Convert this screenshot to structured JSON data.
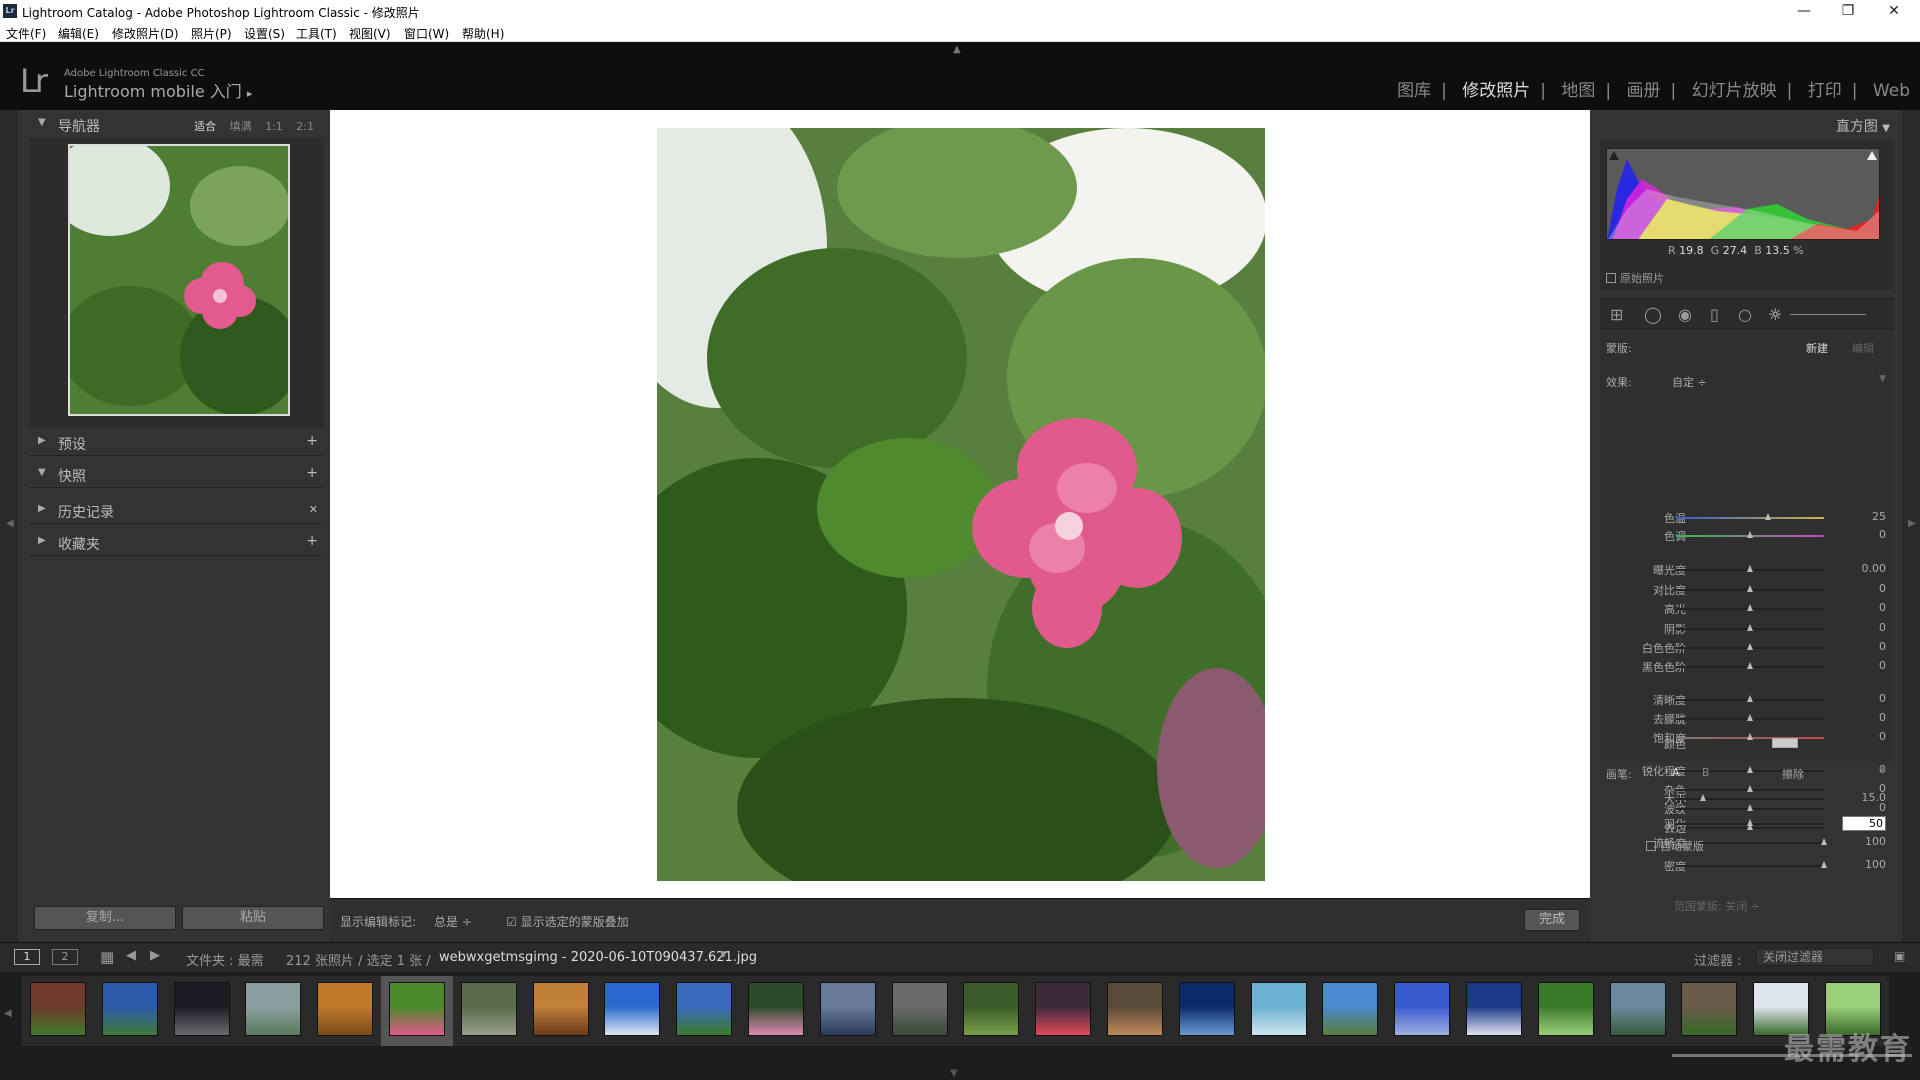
{
  "titlebar": {
    "title": "Lightroom Catalog - Adobe Photoshop Lightroom Classic - 修改照片",
    "icon": "Lr",
    "minimize": "—",
    "maximize": "❐",
    "close": "✕"
  },
  "menu": [
    "文件(F)",
    "编辑(E)",
    "修改照片(D)",
    "照片(P)",
    "设置(S)",
    "工具(T)",
    "视图(V)",
    "窗口(W)",
    "帮助(H)"
  ],
  "identity": {
    "logo": "Lr",
    "line1": "Adobe Lightroom Classic CC",
    "line2": "Lightroom mobile 入门",
    "arrow": "▸"
  },
  "modules": [
    {
      "label": "图库",
      "active": false
    },
    {
      "label": "修改照片",
      "active": true
    },
    {
      "label": "地图",
      "active": false
    },
    {
      "label": "画册",
      "active": false
    },
    {
      "label": "幻灯片放映",
      "active": false
    },
    {
      "label": "打印",
      "active": false
    },
    {
      "label": "Web",
      "active": false
    }
  ],
  "left": {
    "navigator": {
      "title": "导航器",
      "zoom": [
        "适合",
        "填满",
        "1:1",
        "2:1"
      ],
      "selected_zoom": "适合"
    },
    "panels": [
      {
        "title": "预设",
        "action": "+"
      },
      {
        "title": "快照",
        "action": "+"
      },
      {
        "title": "历史记录",
        "action": "✕"
      },
      {
        "title": "收藏夹",
        "action": "+"
      }
    ],
    "copy_button": "复制...",
    "paste_button": "粘贴"
  },
  "toolbar": {
    "edit_label": "显示编辑标记:",
    "edit_value": "总是",
    "overlay_label": "显示选定的蒙版叠加",
    "overlay_checked": true,
    "done": "完成"
  },
  "right": {
    "histogram_title": "直方图",
    "rgb": {
      "r_label": "R",
      "r": "19.8",
      "g_label": "G",
      "g": "27.4",
      "b_label": "B",
      "b": "13.5",
      "unit": "%"
    },
    "original_label": "原始照片",
    "mask_label": "蒙版:",
    "mask_new": "新建",
    "mask_edit": "编辑",
    "effect_label": "效果:",
    "effect_value": "自定 ÷",
    "sliders": [
      {
        "label": "色温",
        "value": "25",
        "pos": 0.62
      },
      {
        "label": "色调",
        "value": "0",
        "pos": 0.5
      },
      {
        "label": "曝光度",
        "value": "0.00",
        "pos": 0.5
      },
      {
        "label": "对比度",
        "value": "0",
        "pos": 0.5
      },
      {
        "label": "高光",
        "value": "0",
        "pos": 0.5
      },
      {
        "label": "阴影",
        "value": "0",
        "pos": 0.5
      },
      {
        "label": "白色色阶",
        "value": "0",
        "pos": 0.5
      },
      {
        "label": "黑色色阶",
        "value": "0",
        "pos": 0.5
      },
      {
        "label": "清晰度",
        "value": "0",
        "pos": 0.5
      },
      {
        "label": "去朦胧",
        "value": "0",
        "pos": 0.5
      },
      {
        "label": "饱和度",
        "value": "0",
        "pos": 0.5
      },
      {
        "label": "锐化程度",
        "value": "0",
        "pos": 0.5
      },
      {
        "label": "杂色",
        "value": "0",
        "pos": 0.5
      },
      {
        "label": "波纹",
        "value": "0",
        "pos": 0.5
      },
      {
        "label": "去边",
        "value": "0",
        "pos": 0.5
      }
    ],
    "color_label": "颜色",
    "brush_label": "画笔:",
    "brush_a": "A",
    "brush_b": "B",
    "brush_erase": "擦除",
    "brush_sliders": [
      {
        "label": "大小",
        "value": "15.0",
        "pos": 0.18
      },
      {
        "label": "羽化",
        "value": "50",
        "pos": 0.5
      },
      {
        "label": "流畅度",
        "value": "100",
        "pos": 1.0
      }
    ],
    "auto_mask": "自动蒙版",
    "density": {
      "label": "密度",
      "value": "100",
      "pos": 1.0
    },
    "range_mask": "范围蒙版: 关闭 ÷"
  },
  "filmbar": {
    "view1": "1",
    "view2": "2",
    "folder": "文件夹 : 最需",
    "count": "212 张照片 / 选定 1 张 /",
    "filename": "webwxgetmsgimg - 2020-06-10T090437.621.jpg",
    "filter_label": "过滤器 :",
    "filter_value": "关闭过滤器"
  },
  "watermark": "最需教育",
  "colors": {
    "accent": "#dddddd",
    "panel": "#333333",
    "bg": "#282828"
  }
}
